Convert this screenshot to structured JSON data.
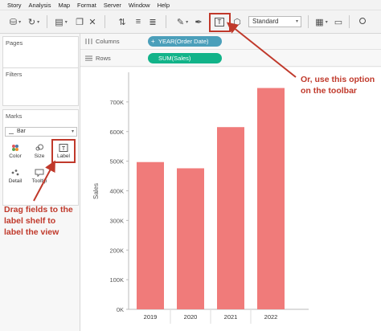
{
  "menu": [
    "Story",
    "Analysis",
    "Map",
    "Format",
    "Server",
    "Window",
    "Help"
  ],
  "toolbar": {
    "t_icon_letter": "T",
    "fit_select": "Standard"
  },
  "left_panel": {
    "pages_title": "Pages",
    "filters_title": "Filters",
    "marks_title": "Marks",
    "mark_type": "Bar",
    "buttons": [
      {
        "label": "Color",
        "icon": "color-icon"
      },
      {
        "label": "Size",
        "icon": "size-icon"
      },
      {
        "label": "Label",
        "icon": "label-icon"
      },
      {
        "label": "Detail",
        "icon": "detail-icon"
      },
      {
        "label": "Tooltip",
        "icon": "tooltip-icon"
      }
    ]
  },
  "shelves": {
    "columns_label": "Columns",
    "columns_pill": "YEAR(Order Date)",
    "rows_label": "Rows",
    "rows_pill": "SUM(Sales)"
  },
  "chart_data": {
    "type": "bar",
    "categories": [
      "2019",
      "2020",
      "2021",
      "2022"
    ],
    "values": [
      497000,
      476000,
      615000,
      747000
    ],
    "ylabel": "Sales",
    "ylim": [
      0,
      800000
    ],
    "yticks": [
      "0K",
      "100K",
      "200K",
      "300K",
      "400K",
      "500K",
      "600K",
      "700K"
    ],
    "bar_color": "#f07b7a",
    "grid": false
  },
  "annotations": {
    "toolbar_note": [
      "Or, use this option",
      "on the toolbar"
    ],
    "shelf_note": [
      "Drag fields to the",
      "label shelf to",
      "label the view"
    ],
    "color": "#c0392b"
  }
}
